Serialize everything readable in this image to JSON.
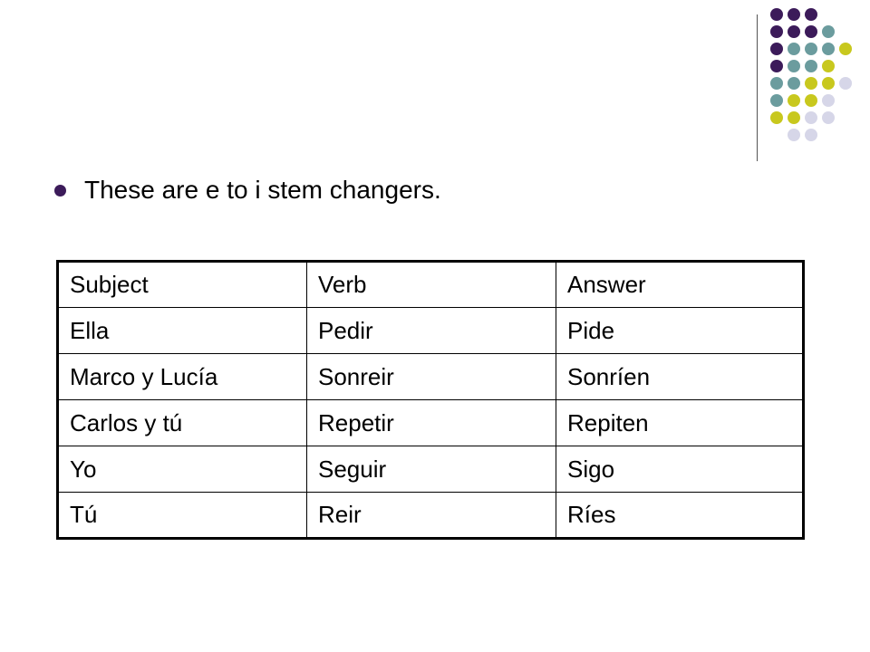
{
  "colors": {
    "purple": "#3c1b5a",
    "teal": "#6b9c9e",
    "olive": "#c8c81e",
    "lavender": "#d6d6e8"
  },
  "decoration": {
    "dot_rows": [
      [
        "purple",
        "purple",
        "purple"
      ],
      [
        "purple",
        "purple",
        "purple",
        "teal"
      ],
      [
        "purple",
        "teal",
        "teal",
        "teal",
        "olive"
      ],
      [
        "purple",
        "teal",
        "teal",
        "olive"
      ],
      [
        "teal",
        "teal",
        "olive",
        "olive",
        "lavender"
      ],
      [
        "teal",
        "olive",
        "olive",
        "lavender"
      ],
      [
        "olive",
        "olive",
        "lavender",
        "lavender"
      ],
      [
        "lavender",
        "lavender"
      ]
    ]
  },
  "bullet": {
    "text": "These are e to i stem changers."
  },
  "table": {
    "header": [
      "Subject",
      "Verb",
      "Answer"
    ],
    "rows": [
      [
        "Ella",
        "Pedir",
        "Pide"
      ],
      [
        "Marco y Lucía",
        "Sonreir",
        "Sonríen"
      ],
      [
        "Carlos y tú",
        "Repetir",
        "Repiten"
      ],
      [
        "Yo",
        "Seguir",
        "Sigo"
      ],
      [
        "Tú",
        "Reir",
        "Ríes"
      ]
    ]
  }
}
